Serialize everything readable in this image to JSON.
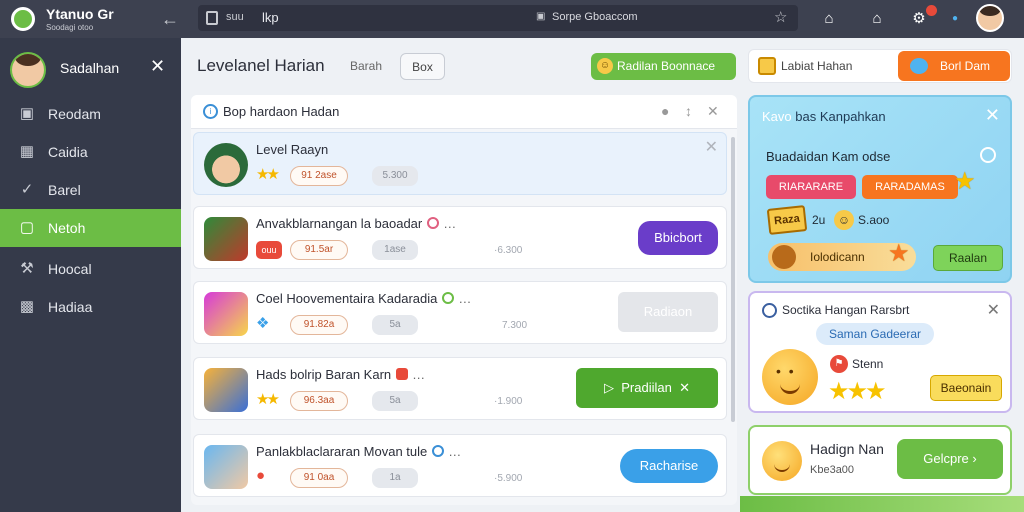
{
  "topbar": {
    "brand_name": "Ytanuo Gr",
    "brand_sub": "Soodagi otoo",
    "url_mid": "suu",
    "url_path": "lkp",
    "url_domain": "Sorpe Gboaccom"
  },
  "sidebar": {
    "user_name": "Sadalhan",
    "items": [
      {
        "label": "Reodam",
        "icon": "calendar-icon"
      },
      {
        "label": "Caidia",
        "icon": "bookmark-icon"
      },
      {
        "label": "Barel",
        "icon": "check-circle-icon"
      },
      {
        "label": "Netoh",
        "icon": "document-icon",
        "active": true
      },
      {
        "label": "Hoocal",
        "icon": "wrench-icon"
      },
      {
        "label": "Hadiaa",
        "icon": "bar-chart-icon"
      }
    ]
  },
  "main": {
    "title": "Levelanel Harian",
    "search_label": "Barah",
    "button_label": "Box",
    "green_pill_label": "Radilan Boonnace"
  },
  "list": {
    "header_title": "Bop hardaon Hadan",
    "rows": [
      {
        "title": "Level Raayn",
        "chip": "91 2ase",
        "chip2": "5.300",
        "meta": ""
      },
      {
        "title": "Anvakblarnangan la baoadar",
        "chip": "91.5ar",
        "chip2": "1ase",
        "meta": "·6.300",
        "badge": "ouu",
        "button": "Bbicbort"
      },
      {
        "title": "Coel Hoovementaira Kadaradia",
        "chip": "91.82a",
        "chip2": "5a",
        "meta": "7.300",
        "button": "Radiaon"
      },
      {
        "title": "Hads bolrip Baran Karn",
        "chip": "96.3aa",
        "chip2": "5a",
        "meta": "·1.900",
        "button": "Pradiilan"
      },
      {
        "title": "Panlakblaclararan Movan tule",
        "chip": "91 0aa",
        "chip2": "1a",
        "meta": "·5.900",
        "button": "Racharise"
      }
    ]
  },
  "right": {
    "top_label": "Labiat Hahan",
    "top_button": "Borl Dam",
    "blue_card": {
      "title_k": "Kavo",
      "title": "bas Kanpahkan",
      "subtitle": "Buadaidan Kam odse",
      "tag1": "RIARARARE",
      "tag2": "RARADAMAS",
      "ticket": "Raza",
      "num1": "2u",
      "num2": "S.aoo",
      "bar_text": "Iolodicann",
      "button": "Raalan"
    },
    "white_card": {
      "title": "Soctika Hangan Rarsbrt",
      "chip": "Saman Gadeerar",
      "label": "Stenn",
      "button": "Baeonain"
    },
    "bottom_card": {
      "title": "Hadign Nan",
      "sub": "Kbe3a00",
      "button": "Gelcpre"
    }
  }
}
